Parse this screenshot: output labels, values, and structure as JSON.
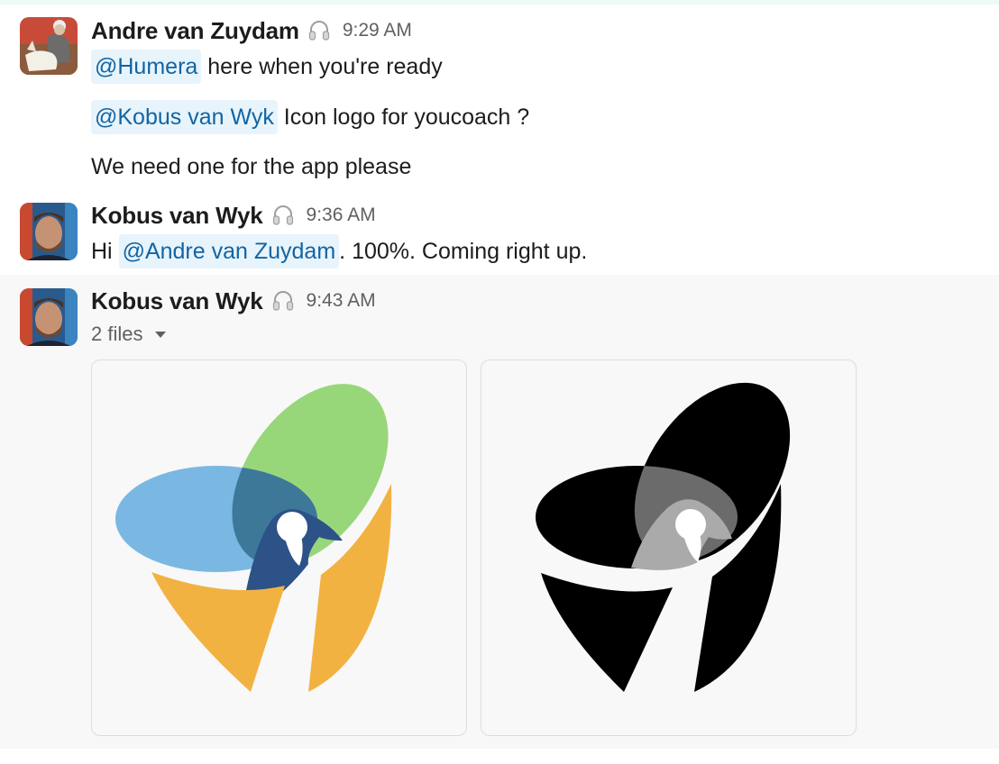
{
  "messages": [
    {
      "sender": "Andre van Zuydam",
      "time": "9:29 AM",
      "lines": [
        {
          "mention": "@Humera",
          "text": " here when you're ready"
        },
        {
          "mention": "@Kobus van Wyk",
          "text": " Icon logo for youcoach ?"
        },
        {
          "text": "We need one for the app please"
        }
      ]
    },
    {
      "sender": "Kobus van Wyk",
      "time": "9:36 AM",
      "lines": [
        {
          "prefix": "Hi ",
          "mention": "@Andre van Zuydam",
          "text": ". 100%. Coming right up."
        }
      ]
    },
    {
      "sender": "Kobus van Wyk",
      "time": "9:43 AM",
      "files_label": "2 files",
      "attachments": [
        {
          "icon": "color-logo",
          "colors": {
            "blue": "#7ab8e3",
            "green": "#98d67a",
            "overlap_blue_green": "#3d7898",
            "navy": "#2c5288",
            "orange": "#f2b241"
          }
        },
        {
          "icon": "monochrome-logo",
          "colors": {
            "black": "#000000",
            "gray_dark": "#6b6b6b",
            "gray_light": "#aaaaaa"
          }
        }
      ]
    }
  ],
  "colors": {
    "mention_bg": "#e8f4fb",
    "mention_text": "#1264a3",
    "hover_bg": "#f8f8f8",
    "timestamp": "#616061"
  }
}
